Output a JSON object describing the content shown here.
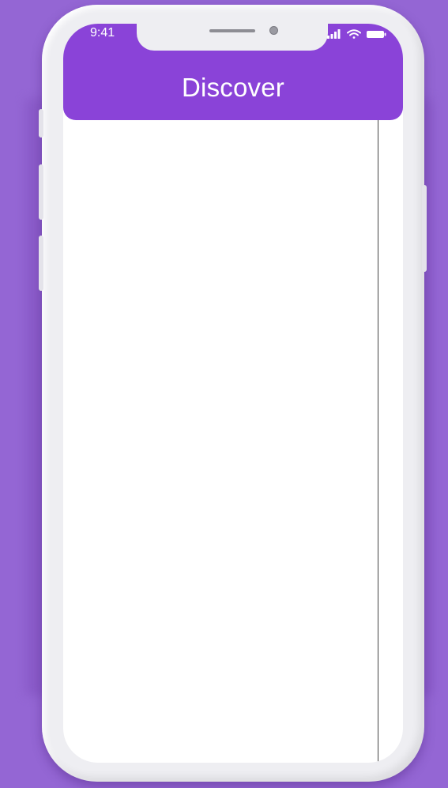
{
  "status_bar": {
    "time": "9:41",
    "icons": [
      "signal-icon",
      "wifi-icon",
      "battery-icon"
    ]
  },
  "app_bar": {
    "title": "Discover",
    "color": "#8a43d8"
  },
  "background_color": "#9466d4"
}
